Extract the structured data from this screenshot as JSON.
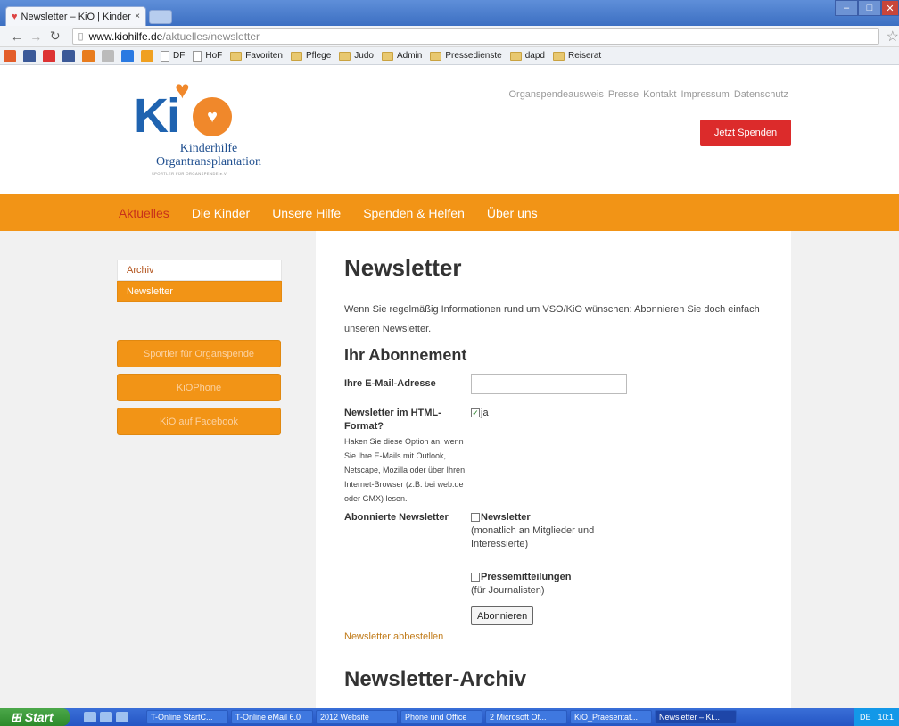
{
  "browser": {
    "tab_title": "Newsletter – KiO | Kinderhilfe",
    "close_glyph": "×",
    "url_host": "www.kiohilfe.de",
    "url_path": "/aktuelles/newsletter",
    "bookmarks": [
      "DF",
      "HoF",
      "Favoriten",
      "Pflege",
      "Judo",
      "Admin",
      "Pressedienste",
      "dapd",
      "Reiserat"
    ]
  },
  "header": {
    "logo_name_line1": "Kinderhilfe",
    "logo_name_line2": "Organtransplantation",
    "logo_sub": "SPORTLER FÜR ORGANSPENDE e.V.",
    "top_links": [
      "Organspendeausweis",
      "Presse",
      "Kontakt",
      "Impressum",
      "Datenschutz"
    ],
    "donate_label": "Jetzt Spenden"
  },
  "mainnav": [
    "Aktuelles",
    "Die Kinder",
    "Unsere Hilfe",
    "Spenden & Helfen",
    "Über uns"
  ],
  "sidebar": {
    "items": [
      "Archiv",
      "Newsletter"
    ],
    "buttons": [
      "Sportler für Organspende",
      "KiOPhone",
      "KiO auf Facebook"
    ]
  },
  "main": {
    "title": "Newsletter",
    "intro": "Wenn Sie regelmäßig Informationen rund um VSO/KiO wünschen: Abonnieren Sie doch einfach unseren Newsletter.",
    "subscription_heading": "Ihr Abonnement",
    "email_label": "Ihre E-Mail-Adresse",
    "email_value": "",
    "html_label": "Newsletter im HTML-Format?",
    "html_help": "Haken Sie diese Option an, wenn Sie Ihre E-Mails mit Outlook, Netscape, Mozilla oder über Ihren Internet-Browser (z.B. bei web.de oder GMX) lesen.",
    "html_option": "ja",
    "html_checked": true,
    "subscribed_label": "Abonnierte Newsletter",
    "newsletters": [
      {
        "name": "Newsletter",
        "desc": "(monatlich an Mitglieder und Interessierte)"
      },
      {
        "name": "Pressemitteilungen",
        "desc": "(für Journalisten)"
      }
    ],
    "submit_label": "Abonnieren",
    "unsubscribe_link": "Newsletter abbestellen",
    "archive_heading": "Newsletter-Archiv"
  },
  "taskbar": {
    "start_label": "Start",
    "items": [
      "T-Online StartC...",
      "T-Online eMail 6.0",
      "2012 Website",
      "Phone und Office",
      "2 Microsoft Of...",
      "KiO_Praesentat...",
      "Newsletter – Ki..."
    ],
    "lang": "DE",
    "clock": "10:1"
  },
  "colors": {
    "brand_orange": "#f29416",
    "brand_blue": "#1f63b0",
    "donate_red": "#dc2b2b"
  }
}
